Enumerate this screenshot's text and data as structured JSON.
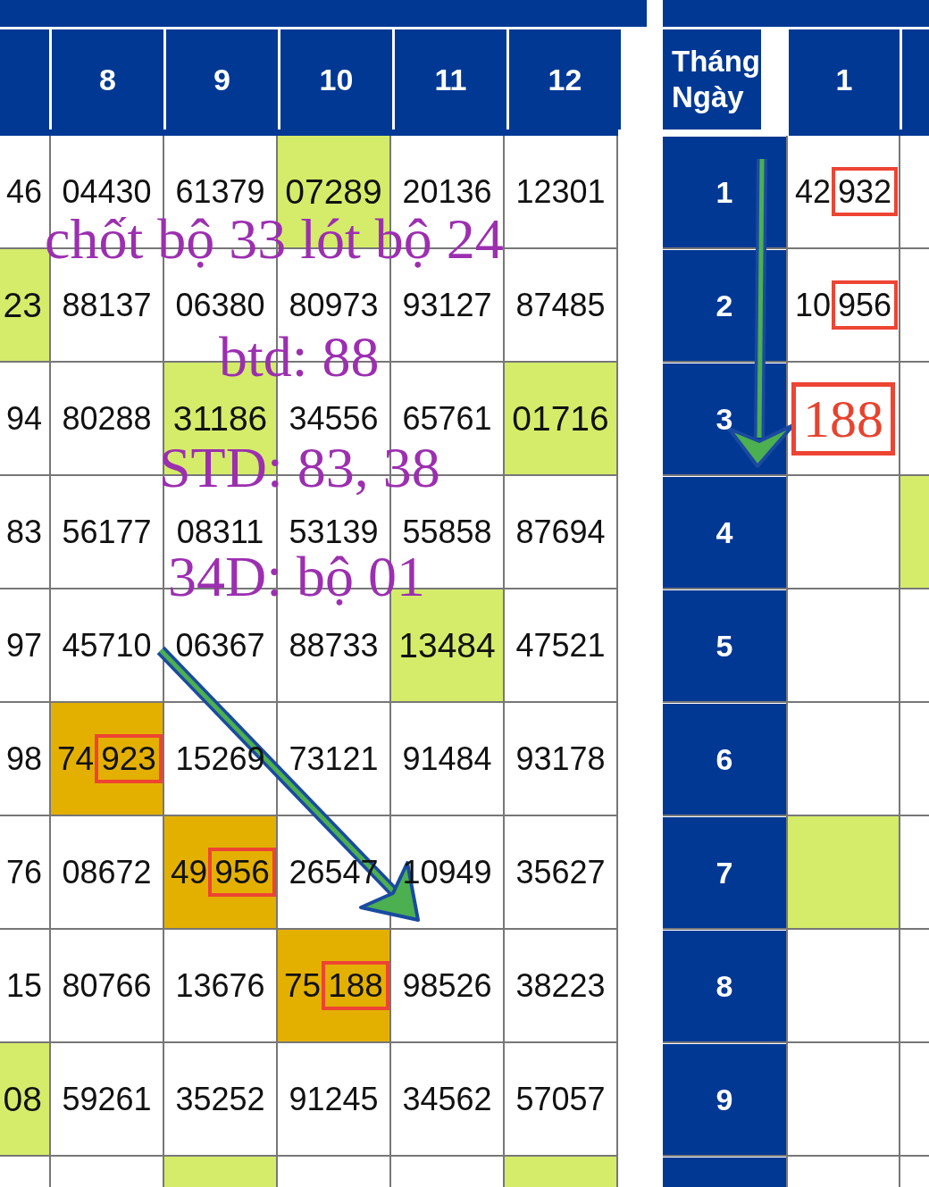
{
  "left_table": {
    "columns": [
      {},
      {
        "label": "8"
      },
      {
        "label": "9"
      },
      {
        "label": "10"
      },
      {
        "label": "11"
      },
      {
        "label": "12"
      }
    ],
    "rows": [
      {
        "cells": [
          {
            "text": "46"
          },
          {
            "text": "04430"
          },
          {
            "text": "61379"
          },
          {
            "text": "07289",
            "color": "#d4ec6a"
          },
          {
            "text": "20136"
          },
          {
            "text": "12301"
          }
        ]
      },
      {
        "cells": [
          {
            "text": "23",
            "color": "#d4ec6a"
          },
          {
            "text": "88137"
          },
          {
            "text": "06380"
          },
          {
            "text": "80973"
          },
          {
            "text": "93127"
          },
          {
            "text": "87485"
          }
        ]
      },
      {
        "cells": [
          {
            "text": "94"
          },
          {
            "text": "80288"
          },
          {
            "text": "31186",
            "color": "#d4ec6a"
          },
          {
            "text": "34556"
          },
          {
            "text": "65761"
          },
          {
            "text": "01716",
            "color": "#d4ec6a"
          }
        ]
      },
      {
        "cells": [
          {
            "text": "83"
          },
          {
            "text": "56177"
          },
          {
            "text": "08311"
          },
          {
            "text": "53139"
          },
          {
            "text": "55858"
          },
          {
            "text": "87694"
          }
        ]
      },
      {
        "cells": [
          {
            "text": "97"
          },
          {
            "text": "45710"
          },
          {
            "text": "06367"
          },
          {
            "text": "88733"
          },
          {
            "text": "13484",
            "color": "#d4ec6a"
          },
          {
            "text": "47521"
          }
        ]
      },
      {
        "cells": [
          {
            "text": "98"
          },
          {
            "text": "74",
            "boxed_text": "923",
            "color": "#e3b000"
          },
          {
            "text": "15269"
          },
          {
            "text": "73121"
          },
          {
            "text": "91484"
          },
          {
            "text": "93178"
          }
        ]
      },
      {
        "cells": [
          {
            "text": "76"
          },
          {
            "text": "08672"
          },
          {
            "text": "49",
            "boxed_text": "956",
            "color": "#e3b000"
          },
          {
            "text": "26547"
          },
          {
            "text": "10949"
          },
          {
            "text": "35627"
          }
        ]
      },
      {
        "cells": [
          {
            "text": "15"
          },
          {
            "text": "80766"
          },
          {
            "text": "13676"
          },
          {
            "text": "75",
            "boxed_text": "188",
            "color": "#e3b000"
          },
          {
            "text": "98526"
          },
          {
            "text": "38223"
          }
        ]
      },
      {
        "cells": [
          {
            "text": "08",
            "color": "#d4ec6a"
          },
          {
            "text": "59261"
          },
          {
            "text": "35252"
          },
          {
            "text": "91245"
          },
          {
            "text": "34562"
          },
          {
            "text": "57057"
          }
        ]
      },
      {
        "cells": [
          {},
          {},
          {
            "color": "#d4ec6a"
          },
          {},
          {},
          {
            "color": "#d4ec6a"
          }
        ]
      }
    ]
  },
  "right_table": {
    "corner_label": "Tháng Ngày",
    "columns": [
      {
        "label": "1"
      },
      {}
    ],
    "rows": [
      {
        "day": "1",
        "cells": [
          {
            "text": "42",
            "boxed_text": "932"
          },
          {}
        ]
      },
      {
        "day": "2",
        "cells": [
          {
            "text": "10",
            "boxed_text": "956"
          },
          {}
        ]
      },
      {
        "day": "3",
        "cells": [
          {
            "annotation": "188"
          },
          {}
        ]
      },
      {
        "day": "4",
        "cells": [
          {},
          {
            "color": "#d4ec6a"
          }
        ]
      },
      {
        "day": "5",
        "cells": [
          {},
          {}
        ]
      },
      {
        "day": "6",
        "cells": [
          {},
          {}
        ]
      },
      {
        "day": "7",
        "cells": [
          {
            "color": "#d4ec6a"
          },
          {}
        ]
      },
      {
        "day": "8",
        "cells": [
          {},
          {}
        ]
      },
      {
        "day": "9",
        "cells": [
          {},
          {}
        ]
      },
      {
        "cells": [
          {},
          {}
        ]
      }
    ]
  },
  "annotations": [
    {
      "text": "chốt bộ 33 lót bộ 24"
    },
    {
      "text": "btd: 88"
    },
    {
      "text": "STD: 83, 38"
    },
    {
      "text": "34D: bộ 01"
    }
  ]
}
